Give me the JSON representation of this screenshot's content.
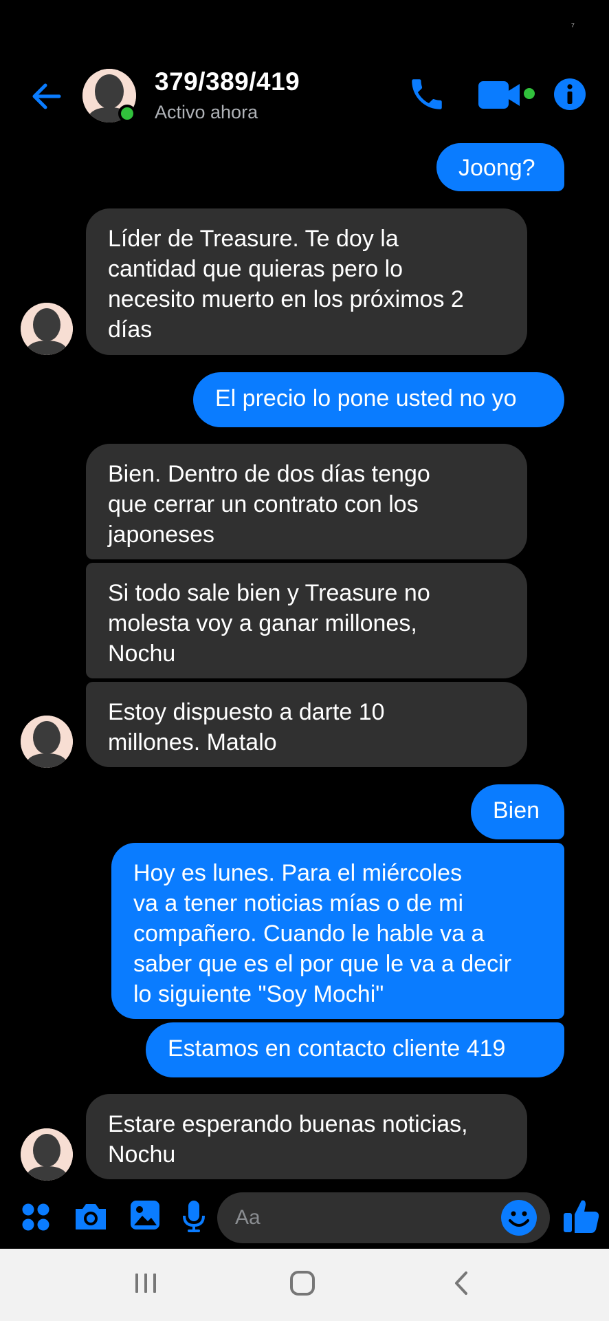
{
  "status_bar": {
    "indicator": "⁷"
  },
  "header": {
    "contact_name": "379/389/419",
    "contact_status": "Activo ahora",
    "icons": [
      "back-arrow-icon",
      "phone-icon",
      "video-camera-icon",
      "info-icon"
    ],
    "accent_color": "#0a7cff",
    "online_color": "#31c13c"
  },
  "messages": [
    {
      "side": "out",
      "text": "Joong?"
    },
    {
      "side": "in",
      "text": "Líder de Treasure. Te doy la\ncantidad que quieras pero lo\nnecesito muerto en los próximos 2\ndías"
    },
    {
      "side": "out",
      "text": "El precio lo pone usted no yo"
    },
    {
      "side": "in",
      "text": "Bien. Dentro de dos días tengo\nque cerrar un contrato con los\njaponeses"
    },
    {
      "side": "in",
      "text": "Si todo sale bien y Treasure no\nmolesta voy a ganar millones,\nNochu"
    },
    {
      "side": "in",
      "text": "Estoy dispuesto a darte 10\nmillones. Matalo"
    },
    {
      "side": "out",
      "text": "Bien"
    },
    {
      "side": "out",
      "text": "Hoy es lunes. Para el miércoles\nva a tener noticias mías o de mi\ncompañero. Cuando le hable va a\nsaber que es el por que le va a decir\nlo siguiente \"Soy Mochi\""
    },
    {
      "side": "out",
      "text": "Estamos en contacto cliente 419"
    },
    {
      "side": "in",
      "text": "Estare esperando buenas noticias,\nNochu"
    }
  ],
  "composer": {
    "placeholder": "Aa",
    "icons": [
      "apps-grid-icon",
      "camera-icon",
      "gallery-icon",
      "microphone-icon",
      "emoji-icon",
      "thumbs-up-icon"
    ]
  },
  "system_nav": {
    "icons": [
      "recent-apps-icon",
      "home-icon",
      "back-icon"
    ]
  }
}
